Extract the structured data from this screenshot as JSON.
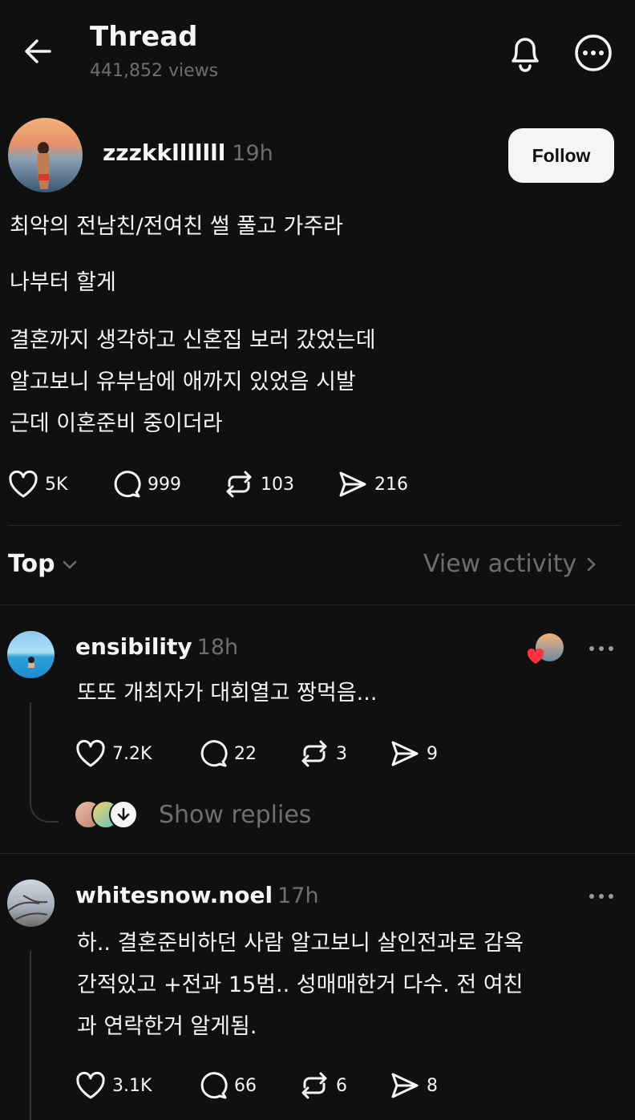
{
  "header": {
    "title": "Thread",
    "views": "441,852 views"
  },
  "post": {
    "username": "zzzkklllllll",
    "time": "19h",
    "follow_label": "Follow",
    "lines": [
      "최악의 전남친/전여친 썰 풀고 가주라",
      "나부터 할게",
      "결혼까지 생각하고 신혼집 보러 갔었는데",
      "알고보니 유부남에 애까지 있었음 시발",
      "근데 이혼준비 중이더라"
    ],
    "likes": "5K",
    "comments": "999",
    "reposts": "103",
    "shares": "216"
  },
  "filter": {
    "sort_label": "Top",
    "activity_label": "View activity"
  },
  "replies": [
    {
      "username": "ensibility",
      "time": "18h",
      "text": "또또 개최자가 대회열고 짱먹음...",
      "likes": "7.2K",
      "comments": "22",
      "reposts": "3",
      "shares": "9",
      "show_replies_label": "Show replies"
    },
    {
      "username": "whitesnow.noel",
      "time": "17h",
      "lines": [
        "하.. 결혼준비하던 사람 알고보니 살인전과로 감옥",
        "간적있고 +전과 15범.. 성매매한거 다수. 전 여친",
        "과 연락한거 알게됨."
      ],
      "likes": "3.1K",
      "comments": "66",
      "reposts": "6",
      "shares": "8"
    }
  ],
  "colors": {
    "background": "#101010",
    "text": "#f3f5f7",
    "muted": "#6e6e6e",
    "heart": "#ff3040"
  }
}
